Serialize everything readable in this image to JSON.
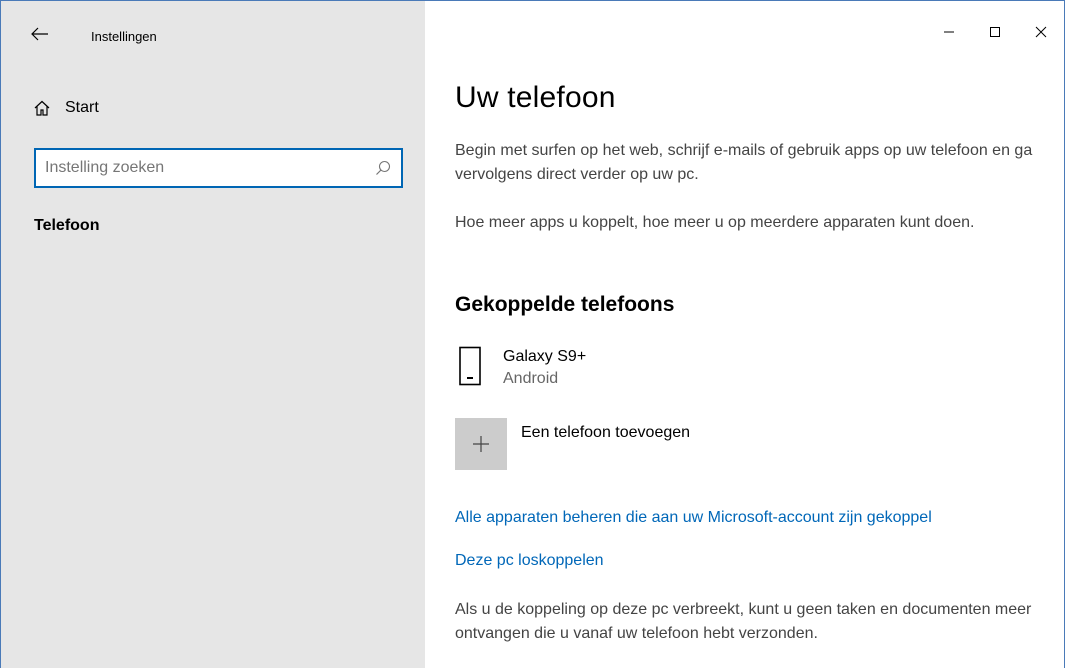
{
  "window": {
    "app_title": "Instellingen",
    "controls": {
      "minimize": "—",
      "maximize": "☐",
      "close": "✕"
    }
  },
  "sidebar": {
    "start_label": "Start",
    "search": {
      "value": "",
      "placeholder": "Instelling zoeken"
    },
    "active_item": "Telefoon"
  },
  "main": {
    "title": "Uw telefoon",
    "intro1": "Begin met surfen op het web, schrijf e-mails of gebruik apps op uw telefoon en ga vervolgens direct verder op uw pc.",
    "intro2": "Hoe meer apps u koppelt, hoe meer u op meerdere apparaten kunt doen.",
    "linked_phones_title": "Gekoppelde telefoons",
    "device": {
      "name": "Galaxy S9+",
      "os": "Android"
    },
    "add_phone_label": "Een telefoon toevoegen",
    "manage_link": "Alle apparaten beheren die aan uw Microsoft-account zijn gekoppel",
    "unlink_link": "Deze pc loskoppelen",
    "unlink_note": "Als u de koppeling op deze pc verbreekt, kunt u geen taken en documenten meer ontvangen die u vanaf uw telefoon hebt verzonden."
  },
  "colors": {
    "accent": "#0067b8",
    "sidebar_bg": "#e6e6e6",
    "add_tile_bg": "#cccccc"
  },
  "icons": {
    "back": "back-arrow-icon",
    "home": "home-icon",
    "search": "search-icon",
    "phone": "phone-icon",
    "add": "plus-icon"
  }
}
